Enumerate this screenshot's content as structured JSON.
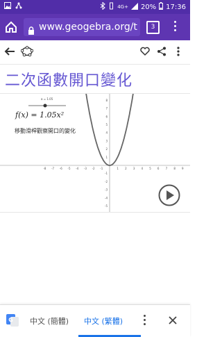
{
  "status_bar": {
    "network": "4G+",
    "battery": "20%",
    "time": "17:36"
  },
  "browser": {
    "url": "www.geogebra.org/t",
    "tab_count": "3"
  },
  "page": {
    "title": "二次函數開口變化"
  },
  "applet": {
    "slider_label": "a = 1.05",
    "formula": "f(x) = 1.05x²",
    "hint": "移動滑桿觀察開口的變化",
    "y_ticks": [
      "8",
      "7",
      "6",
      "5",
      "4",
      "3",
      "2",
      "1",
      "-1",
      "-2",
      "-3",
      "-4",
      "-5"
    ],
    "x_ticks": [
      "-8",
      "-7",
      "-6",
      "-5",
      "-4",
      "-3",
      "-2",
      "-1",
      "1",
      "2",
      "3",
      "4",
      "5",
      "6",
      "7",
      "8",
      "9"
    ]
  },
  "translate_bar": {
    "lang_source": "中文 (簡體)",
    "lang_target": "中文 (繁體)"
  },
  "colors": {
    "status_bar": "#512da8",
    "url_bar": "#5e35b1",
    "title": "#6557d2",
    "translate_active": "#1a73e8"
  }
}
